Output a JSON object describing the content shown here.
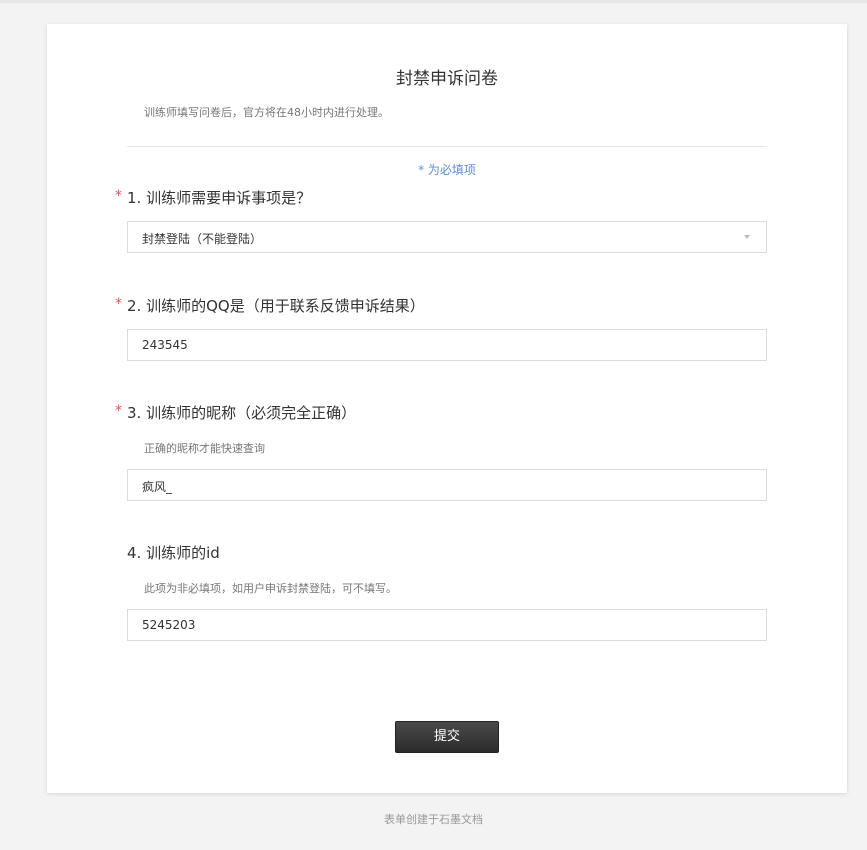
{
  "form": {
    "title": "封禁申诉问卷",
    "description": "训练师填写问卷后，官方将在48小时内进行处理。",
    "required_note": "* 为必填项",
    "submit_label": "提交"
  },
  "questions": [
    {
      "required_mark": "*",
      "title": "1. 训练师需要申诉事项是？",
      "type": "select",
      "value": "封禁登陆（不能登陆）"
    },
    {
      "required_mark": "*",
      "title": "2. 训练师的QQ是（用于联系反馈申诉结果）",
      "type": "text",
      "value": "243545"
    },
    {
      "required_mark": "*",
      "title": "3. 训练师的昵称（必须完全正确）",
      "hint": "正确的昵称才能快速查询",
      "type": "text",
      "value": "疯风_"
    },
    {
      "title": "4. 训练师的id",
      "hint": "此项为非必填项，如用户申诉封禁登陆，可不填写。",
      "type": "text",
      "value": "5245203"
    }
  ],
  "footer": {
    "text": "表单创建于石墨文档"
  },
  "colors": {
    "required_star": "#e0555b",
    "note_blue": "#5b8fd6",
    "button_dark": "#333333",
    "page_bg": "#f3f3f3"
  }
}
